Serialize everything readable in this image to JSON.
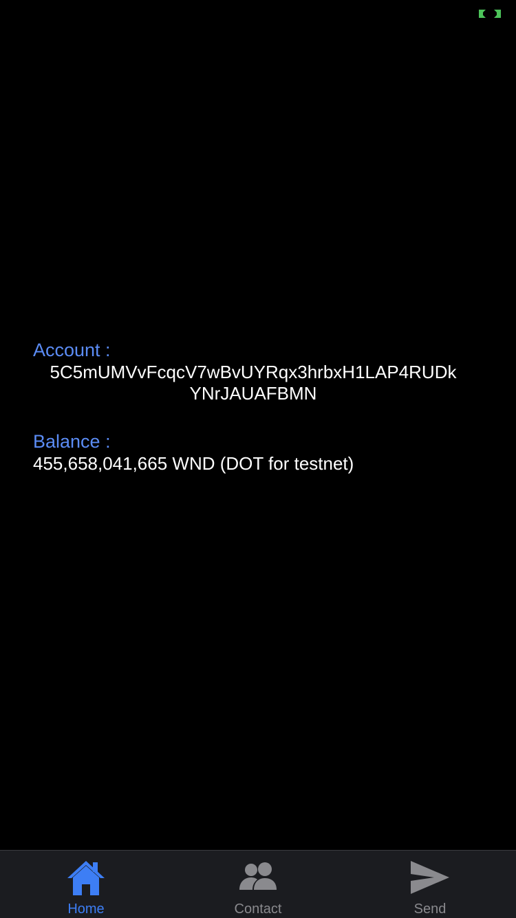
{
  "status": {
    "indicator_icon": "green-bracket-indicator-icon",
    "indicator_color": "#4cc35a"
  },
  "account": {
    "label": "Account :",
    "address_line1": "5C5mUMVvFcqcV7wBvUYRqx3hrbxH1LAP4RUDk",
    "address_line2": "YNrJAUAFBMN"
  },
  "balance": {
    "label": "Balance :",
    "value": "455,658,041,665 WND (DOT for testnet)"
  },
  "tabs": [
    {
      "label": "Home",
      "icon": "home-icon",
      "active": true
    },
    {
      "label": "Contact",
      "icon": "contacts-icon",
      "active": false
    },
    {
      "label": "Send",
      "icon": "send-icon",
      "active": false
    }
  ],
  "colors": {
    "accent": "#3d7ef5",
    "label_blue": "#5b8cf5",
    "inactive": "#8a8a8e",
    "background": "#000000",
    "tab_bar": "#1b1c20"
  }
}
